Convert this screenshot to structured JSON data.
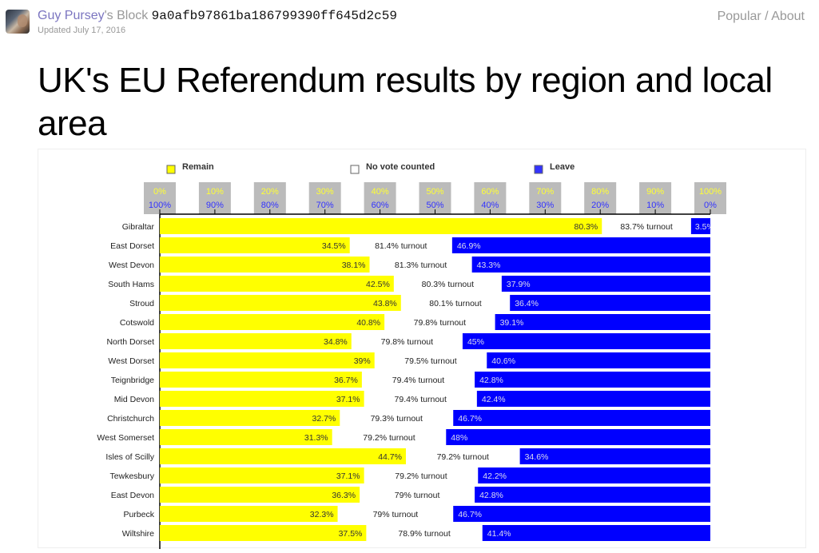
{
  "header": {
    "user": "Guy Pursey",
    "block_suffix": "'s Block",
    "gist_id": "9a0afb97861ba186799390ff645d2c59",
    "updated": "Updated July 17, 2016",
    "nav_popular": "Popular",
    "nav_sep": " / ",
    "nav_about": "About",
    "avatar_icon": "user-avatar"
  },
  "page_title": "UK's EU Referendum results by region and local area",
  "colors": {
    "remain": "#ffff00",
    "leave": "#0000ff",
    "no_vote": "#ffffff",
    "axis_box": "#bbbbbb",
    "remain_tick_text": "#ffff33",
    "leave_tick_text": "#3333ff"
  },
  "chart_data": {
    "type": "bar",
    "subtype": "stacked-horizontal-diverging",
    "title": "UK's EU Referendum results by region and local area",
    "legend": {
      "placement": "top",
      "entries": [
        {
          "name": "Remain",
          "color": "#ffff00"
        },
        {
          "name": "No vote counted",
          "color": "#ffffff"
        },
        {
          "name": "Leave",
          "color": "#3333ff"
        }
      ]
    },
    "axis": {
      "remain_ticks": [
        "0%",
        "10%",
        "20%",
        "30%",
        "40%",
        "50%",
        "60%",
        "70%",
        "80%",
        "90%",
        "100%"
      ],
      "leave_ticks": [
        "100%",
        "90%",
        "80%",
        "70%",
        "60%",
        "50%",
        "40%",
        "30%",
        "20%",
        "10%",
        "0%"
      ],
      "range": [
        0,
        100
      ]
    },
    "categories": [
      "Gibraltar",
      "East Dorset",
      "West Devon",
      "South Hams",
      "Stroud",
      "Cotswold",
      "North Dorset",
      "West Dorset",
      "Teignbridge",
      "Mid Devon",
      "Christchurch",
      "West Somerset",
      "Isles of Scilly",
      "Tewkesbury",
      "East Devon",
      "Purbeck",
      "Wiltshire"
    ],
    "series": [
      {
        "name": "Remain",
        "values": [
          80.3,
          34.5,
          38.1,
          42.5,
          43.8,
          40.8,
          34.8,
          39,
          36.7,
          37.1,
          32.7,
          31.3,
          44.7,
          37.1,
          36.3,
          32.3,
          37.5
        ]
      },
      {
        "name": "Leave",
        "values": [
          3.5,
          46.9,
          43.3,
          37.9,
          36.4,
          39.1,
          45,
          40.6,
          42.8,
          42.4,
          46.7,
          48,
          34.6,
          42.2,
          42.8,
          46.7,
          41.4
        ]
      },
      {
        "name": "Turnout",
        "values": [
          83.7,
          81.4,
          81.3,
          80.3,
          80.1,
          79.8,
          79.8,
          79.5,
          79.4,
          79.4,
          79.3,
          79.2,
          79.2,
          79.2,
          79,
          79,
          78.9
        ]
      }
    ],
    "turnout_suffix": " turnout",
    "value_suffix": "%"
  }
}
